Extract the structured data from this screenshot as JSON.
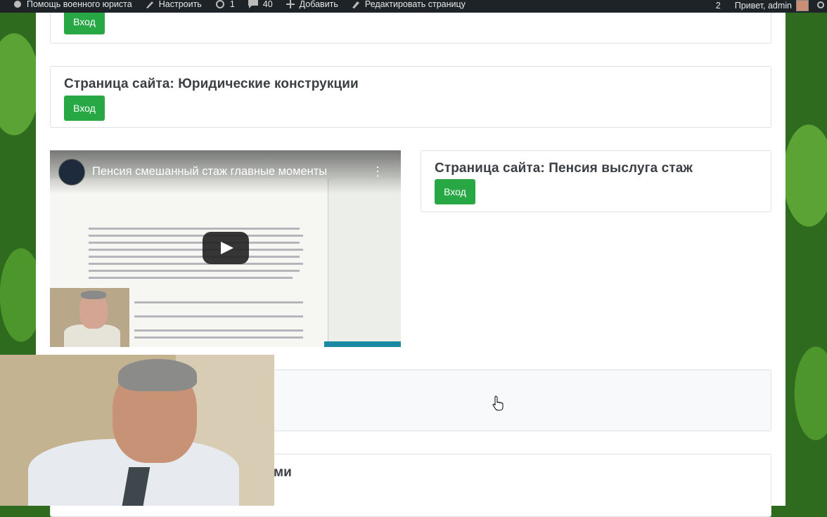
{
  "adminbar": {
    "site_name": "Помощь военного юриста",
    "customize": "Настроить",
    "updates_count": "1",
    "comments_count": "40",
    "add_new": "Добавить",
    "edit_page": "Редактировать страницу",
    "right_count": "2",
    "greeting": "Привет, admin"
  },
  "cards": [
    {
      "title": "",
      "button": "Вход"
    },
    {
      "title": "Страница сайта: Юридические конструкции",
      "button": "Вход"
    },
    {
      "title": "Страница сайта: Пенсия выслуга стаж",
      "button": "Вход"
    },
    {
      "title": ""
    },
    {
      "title": "ми"
    }
  ],
  "video": {
    "title": "Пенсия смешанный стаж главные моменты",
    "menu_glyph": "⋮"
  },
  "colors": {
    "button": "#28a745",
    "adminbar": "#1d2327",
    "background": "#2f6b1e"
  }
}
